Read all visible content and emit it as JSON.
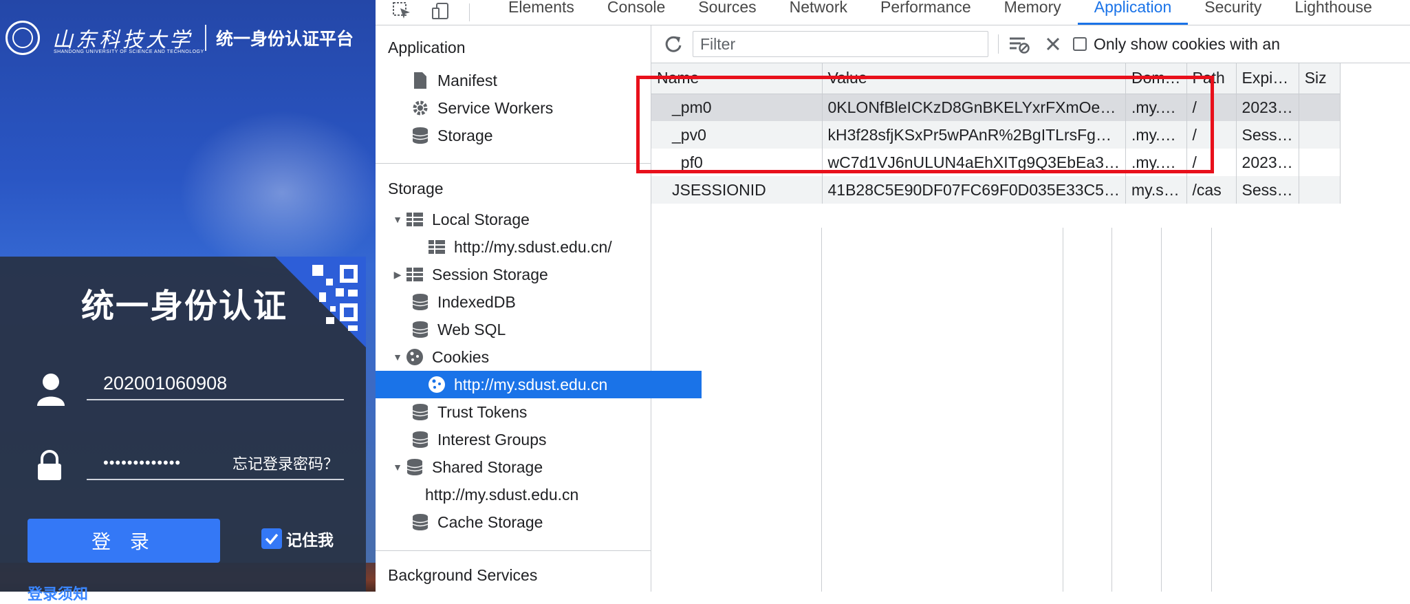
{
  "login_page": {
    "university_name": "山东科技大学",
    "university_en": "SHANDONG UNIVERSITY OF SCIENCE AND TECHNOLOGY",
    "platform_title": "统一身份认证平台",
    "panel_title": "统一身份认证",
    "username_value": "202001060908",
    "password_masked": "•••••••••••••",
    "forgot_password": "忘记登录密码？",
    "login_button": "登 录",
    "remember_me": "记住我",
    "notice_link": "登录须知",
    "colors": {
      "primary": "#3478f6",
      "panel": "#283244"
    }
  },
  "devtools": {
    "tabs": [
      {
        "label": "Elements"
      },
      {
        "label": "Console"
      },
      {
        "label": "Sources"
      },
      {
        "label": "Network"
      },
      {
        "label": "Performance"
      },
      {
        "label": "Memory"
      },
      {
        "label": "Application",
        "active": true
      },
      {
        "label": "Security"
      },
      {
        "label": "Lighthouse"
      }
    ],
    "sidebar": {
      "application_title": "Application",
      "application_items": [
        "Manifest",
        "Service Workers",
        "Storage"
      ],
      "storage_title": "Storage",
      "local_storage": "Local Storage",
      "local_storage_origin": "http://my.sdust.edu.cn/",
      "session_storage": "Session Storage",
      "indexeddb": "IndexedDB",
      "websql": "Web SQL",
      "cookies": "Cookies",
      "cookies_origin": "http://my.sdust.edu.cn",
      "trust_tokens": "Trust Tokens",
      "interest_groups": "Interest Groups",
      "shared_storage": "Shared Storage",
      "shared_storage_origin": "http://my.sdust.edu.cn",
      "cache_storage": "Cache Storage",
      "background_services_title": "Background Services"
    },
    "toolbar": {
      "filter_placeholder": "Filter",
      "only_show_label": "Only show cookies with an"
    },
    "table": {
      "columns": [
        "Name",
        "Value",
        "Dom…",
        "Path",
        "Expi…",
        "Siz"
      ],
      "rows": [
        {
          "name": "_pm0",
          "value": "0KLONfBleICKzD8GnBKELYxrFXmOe…",
          "domain": ".my.…",
          "path": "/",
          "expires": "2023…"
        },
        {
          "name": "_pv0",
          "value": "kH3f28sfjKSxPr5wPAnR%2BgITLrsFg…",
          "domain": ".my.…",
          "path": "/",
          "expires": "Sess…"
        },
        {
          "name": "_pf0",
          "value": "wC7d1VJ6nULUN4aEhXITg9Q3EbEa3…",
          "domain": ".my.…",
          "path": "/",
          "expires": "2023…"
        },
        {
          "name": "JSESSIONID",
          "value": "41B28C5E90DF07FC69F0D035E33C5…",
          "domain": "my.s…",
          "path": "/cas",
          "expires": "Sess…"
        }
      ]
    },
    "colors": {
      "accent": "#1a73e8",
      "annotation": "#e8101b"
    }
  }
}
